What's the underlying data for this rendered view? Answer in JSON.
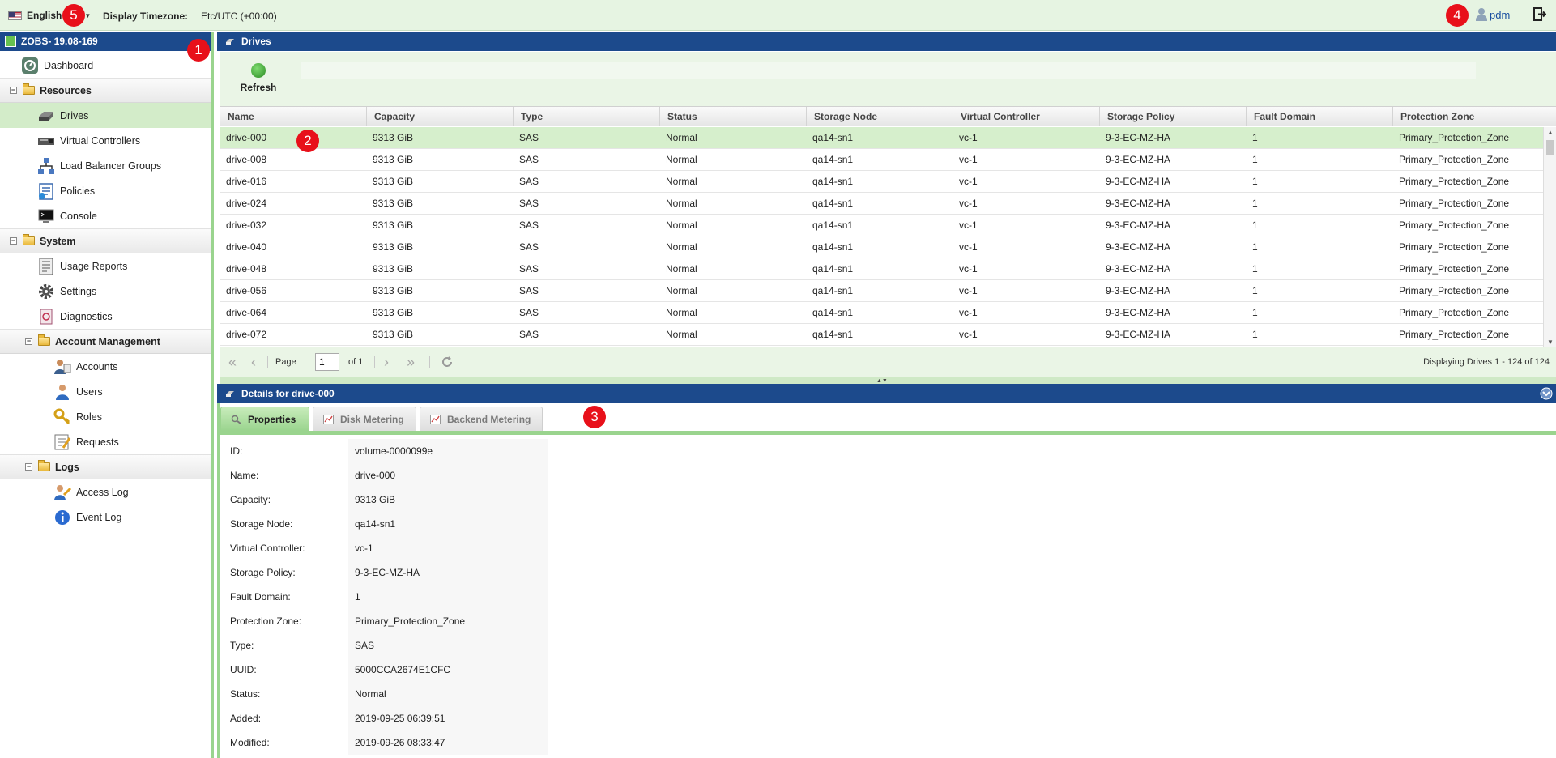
{
  "topbar": {
    "language": "English",
    "timezone_label": "Display Timezone:",
    "timezone_value": "Etc/UTC (+00:00)",
    "user": "pdm"
  },
  "badges": [
    "1",
    "2",
    "3",
    "4",
    "5"
  ],
  "sidebar": {
    "title": "ZOBS- 19.08-169",
    "items": [
      {
        "label": "Dashboard",
        "icon": "dashboard-icon"
      },
      {
        "label": "Resources",
        "icon": "folder-icon",
        "group": true
      },
      {
        "label": "Drives",
        "icon": "drive-icon",
        "active": true
      },
      {
        "label": "Virtual Controllers",
        "icon": "controller-icon"
      },
      {
        "label": "Load Balancer Groups",
        "icon": "network-icon"
      },
      {
        "label": "Policies",
        "icon": "policy-icon"
      },
      {
        "label": "Console",
        "icon": "console-icon"
      },
      {
        "label": "System",
        "icon": "folder-icon",
        "group": true
      },
      {
        "label": "Usage Reports",
        "icon": "report-icon"
      },
      {
        "label": "Settings",
        "icon": "gear-icon"
      },
      {
        "label": "Diagnostics",
        "icon": "diagnostics-icon"
      },
      {
        "label": "Account Management",
        "icon": "folder-icon",
        "group": true
      },
      {
        "label": "Accounts",
        "icon": "accounts-icon"
      },
      {
        "label": "Users",
        "icon": "user-icon"
      },
      {
        "label": "Roles",
        "icon": "key-icon"
      },
      {
        "label": "Requests",
        "icon": "requests-icon"
      },
      {
        "label": "Logs",
        "icon": "folder-icon",
        "group": true
      },
      {
        "label": "Access Log",
        "icon": "access-log-icon"
      },
      {
        "label": "Event Log",
        "icon": "info-icon"
      }
    ]
  },
  "drives_panel": {
    "title": "Drives",
    "refresh_label": "Refresh",
    "columns": [
      "Name",
      "Capacity",
      "Type",
      "Status",
      "Storage Node",
      "Virtual Controller",
      "Storage Policy",
      "Fault Domain",
      "Protection Zone"
    ],
    "rows": [
      [
        "drive-000",
        "9313 GiB",
        "SAS",
        "Normal",
        "qa14-sn1",
        "vc-1",
        "9-3-EC-MZ-HA",
        "1",
        "Primary_Protection_Zone"
      ],
      [
        "drive-008",
        "9313 GiB",
        "SAS",
        "Normal",
        "qa14-sn1",
        "vc-1",
        "9-3-EC-MZ-HA",
        "1",
        "Primary_Protection_Zone"
      ],
      [
        "drive-016",
        "9313 GiB",
        "SAS",
        "Normal",
        "qa14-sn1",
        "vc-1",
        "9-3-EC-MZ-HA",
        "1",
        "Primary_Protection_Zone"
      ],
      [
        "drive-024",
        "9313 GiB",
        "SAS",
        "Normal",
        "qa14-sn1",
        "vc-1",
        "9-3-EC-MZ-HA",
        "1",
        "Primary_Protection_Zone"
      ],
      [
        "drive-032",
        "9313 GiB",
        "SAS",
        "Normal",
        "qa14-sn1",
        "vc-1",
        "9-3-EC-MZ-HA",
        "1",
        "Primary_Protection_Zone"
      ],
      [
        "drive-040",
        "9313 GiB",
        "SAS",
        "Normal",
        "qa14-sn1",
        "vc-1",
        "9-3-EC-MZ-HA",
        "1",
        "Primary_Protection_Zone"
      ],
      [
        "drive-048",
        "9313 GiB",
        "SAS",
        "Normal",
        "qa14-sn1",
        "vc-1",
        "9-3-EC-MZ-HA",
        "1",
        "Primary_Protection_Zone"
      ],
      [
        "drive-056",
        "9313 GiB",
        "SAS",
        "Normal",
        "qa14-sn1",
        "vc-1",
        "9-3-EC-MZ-HA",
        "1",
        "Primary_Protection_Zone"
      ],
      [
        "drive-064",
        "9313 GiB",
        "SAS",
        "Normal",
        "qa14-sn1",
        "vc-1",
        "9-3-EC-MZ-HA",
        "1",
        "Primary_Protection_Zone"
      ],
      [
        "drive-072",
        "9313 GiB",
        "SAS",
        "Normal",
        "qa14-sn1",
        "vc-1",
        "9-3-EC-MZ-HA",
        "1",
        "Primary_Protection_Zone"
      ]
    ],
    "pager": {
      "page_label": "Page",
      "page_value": "1",
      "of_label": "of 1",
      "display_text": "Displaying Drives 1 - 124 of 124"
    }
  },
  "details_panel": {
    "title": "Details for drive-000",
    "tabs": [
      "Properties",
      "Disk Metering",
      "Backend Metering"
    ],
    "properties": [
      {
        "label": "ID:",
        "value": "volume-0000099e"
      },
      {
        "label": "Name:",
        "value": "drive-000"
      },
      {
        "label": "Capacity:",
        "value": "9313 GiB"
      },
      {
        "label": "Storage Node:",
        "value": "qa14-sn1"
      },
      {
        "label": "Virtual Controller:",
        "value": "vc-1"
      },
      {
        "label": "Storage Policy:",
        "value": "9-3-EC-MZ-HA"
      },
      {
        "label": "Fault Domain:",
        "value": "1"
      },
      {
        "label": "Protection Zone:",
        "value": "Primary_Protection_Zone"
      },
      {
        "label": "Type:",
        "value": "SAS"
      },
      {
        "label": "UUID:",
        "value": "5000CCA2674E1CFC"
      },
      {
        "label": "Status:",
        "value": "Normal"
      },
      {
        "label": "Added:",
        "value": "2019-09-25 06:39:51"
      },
      {
        "label": "Modified:",
        "value": "2019-09-26 08:33:47"
      }
    ]
  },
  "colors": {
    "header_blue": "#1c4a8c",
    "accent_green": "#9ad48e",
    "selected_row": "#d6efcc",
    "badge_red": "#e8101a"
  }
}
